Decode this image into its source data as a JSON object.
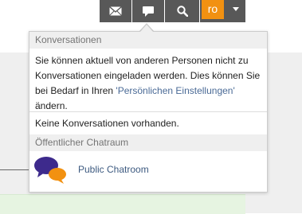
{
  "colors": {
    "topbar_button_bg": "#585858",
    "avatar_bg": "#f29111",
    "link": "#4a6a96",
    "section_header_bg": "#efefef"
  },
  "topbar": {
    "icons": [
      "mail-icon",
      "chat-bubble-icon",
      "search-icon"
    ],
    "user_initials": "ro"
  },
  "dropdown": {
    "conversations_header": "Konversationen",
    "info_text_before_link": "Sie können aktuell von anderen Personen nicht zu Konversationen eingeladen werden. Dies können Sie bei Bedarf in Ihren ",
    "info_link": "'Persönlichen Einstellungen'",
    "info_text_after_link": " ändern.",
    "no_conversations": "Keine Konversationen vorhanden.",
    "public_chat_header": "Öffentlicher Chatraum",
    "public_chat_label": "Public Chatroom"
  }
}
